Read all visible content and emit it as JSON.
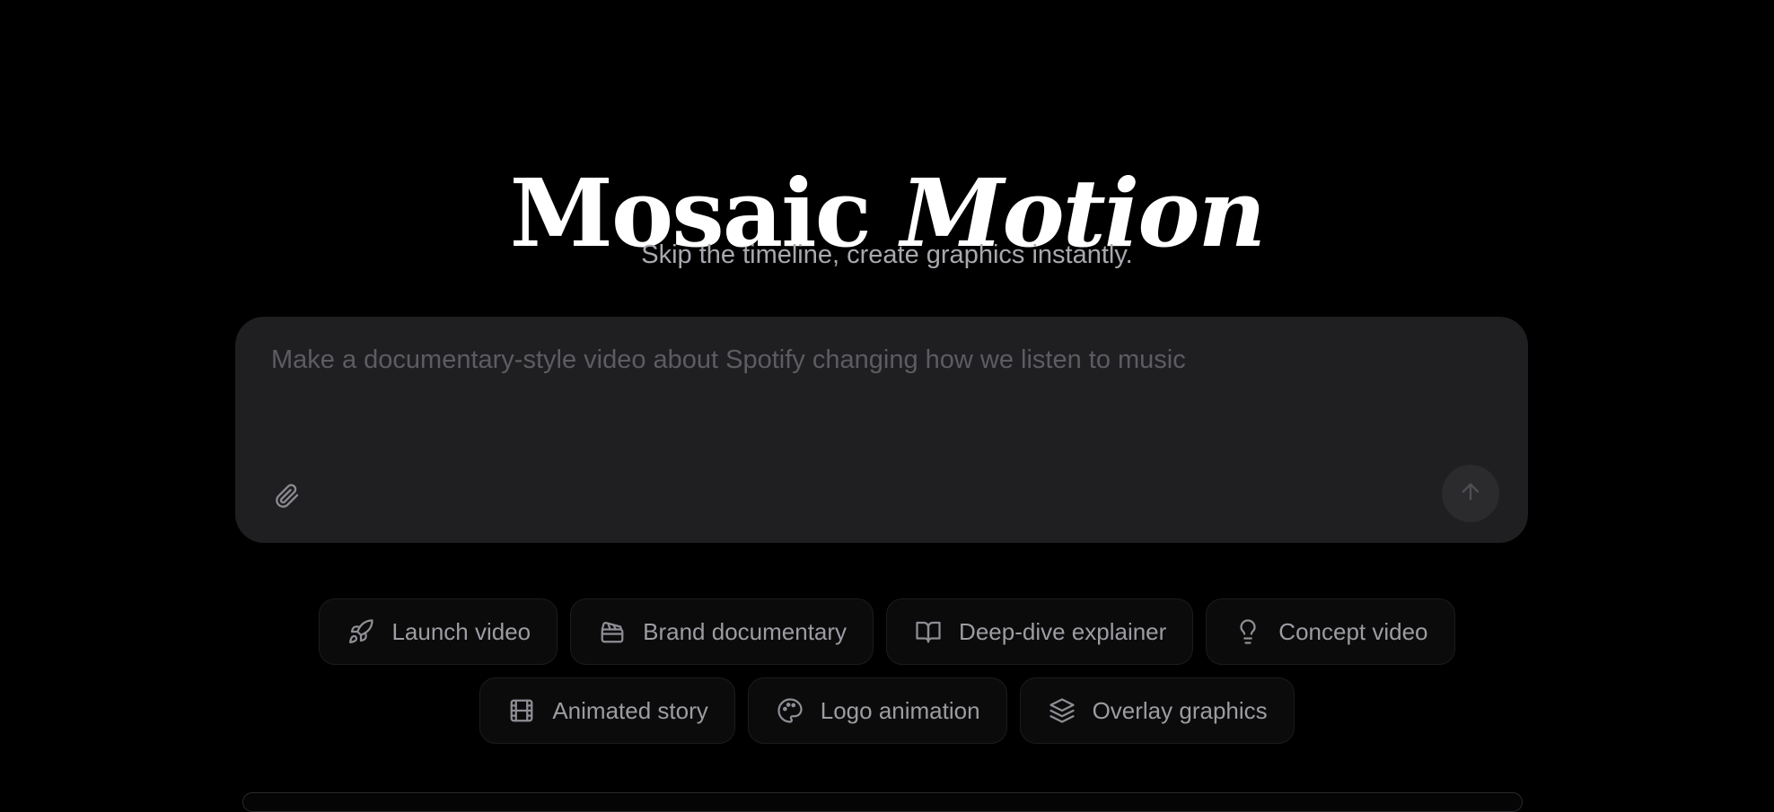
{
  "hero": {
    "title_regular": "Mosaic",
    "title_italic": "Motion",
    "subtitle": "Skip the timeline, create graphics instantly."
  },
  "prompt": {
    "placeholder": "Make a documentary-style video about Spotify changing how we listen to music",
    "value": "",
    "attach_icon": "paperclip-icon",
    "send_icon": "arrow-up-icon"
  },
  "suggestions": {
    "row1": [
      {
        "label": "Launch video",
        "icon": "rocket-icon"
      },
      {
        "label": "Brand documentary",
        "icon": "clapperboard-icon"
      },
      {
        "label": "Deep-dive explainer",
        "icon": "book-open-icon"
      },
      {
        "label": "Concept video",
        "icon": "lightbulb-icon"
      }
    ],
    "row2": [
      {
        "label": "Animated story",
        "icon": "film-icon"
      },
      {
        "label": "Logo animation",
        "icon": "palette-icon"
      },
      {
        "label": "Overlay graphics",
        "icon": "layers-icon"
      }
    ]
  },
  "colors": {
    "background": "#000000",
    "prompt_box": "#1f1f21",
    "chip_bg": "#0b0b0c",
    "chip_text": "#9c9ca2",
    "subtitle_text": "#a8a8ae",
    "placeholder_text": "#5c5c62"
  }
}
